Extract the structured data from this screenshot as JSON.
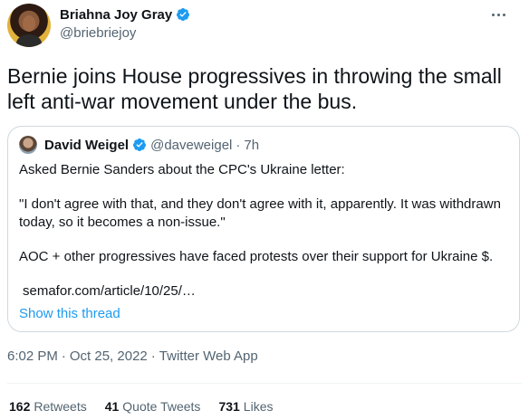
{
  "author": {
    "name": "Briahna Joy Gray",
    "handle": "@briebriejoy"
  },
  "tweet": {
    "text": "Bernie joins House progressives in throwing the small left anti-war movement under the bus."
  },
  "quoted_tweet": {
    "name": "David Weigel",
    "handle": "@daveweigel",
    "separator": "·",
    "time": "7h",
    "lines": [
      "Asked Bernie Sanders about the CPC's Ukraine letter:",
      "\"I don't agree with that, and they don't agree with it, apparently. It was withdrawn today, so it becomes a non-issue.\"",
      "AOC + other progressives have faced protests over their support for Ukraine $."
    ],
    "link": "semafor.com/article/10/25/…",
    "show_thread": "Show this thread"
  },
  "meta": {
    "time": "6:02 PM",
    "sep1": "·",
    "date": "Oct 25, 2022",
    "sep2": "·",
    "app": "Twitter Web App"
  },
  "stats": {
    "retweets_count": "162",
    "retweets_label": "Retweets",
    "quotes_count": "41",
    "quotes_label": "Quote Tweets",
    "likes_count": "731",
    "likes_label": "Likes"
  },
  "colors": {
    "verified": "#1d9bf0",
    "link": "#1d9bf0",
    "secondary_text": "#536471"
  },
  "icons": [
    "verified-icon",
    "more-icon"
  ]
}
